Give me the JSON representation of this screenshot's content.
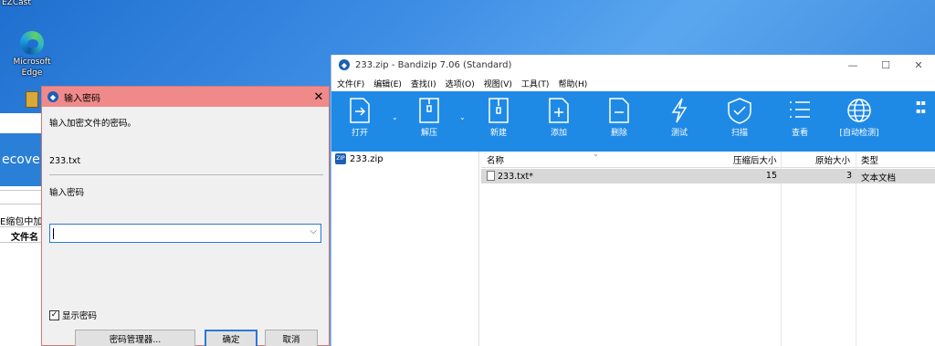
{
  "desktop": {
    "top_label": "EZCast",
    "edge_label_line1": "Microsoft",
    "edge_label_line2": "Edge"
  },
  "background_app": {
    "banner_text": "ecove",
    "text1": "E缩包中加",
    "text2": "文件名"
  },
  "password_dialog": {
    "title": "输入密码",
    "close_glyph": "✕",
    "prompt": "输入加密文件的密码。",
    "filename": "233.txt",
    "field_label": "输入密码",
    "input_value": "",
    "dropdown_glyph": "⌵",
    "show_password_label": "显示密码",
    "show_password_checked": true,
    "manager_button": "密码管理器...",
    "ok_button": "确定",
    "cancel_button": "取消"
  },
  "bandizip": {
    "title": "233.zip - Bandizip 7.06 (Standard)",
    "window_controls": [
      "—",
      "☐",
      "✕"
    ],
    "menu": [
      "文件(F)",
      "编辑(E)",
      "查找(I)",
      "选项(O)",
      "视图(V)",
      "工具(T)",
      "帮助(H)"
    ],
    "toolbar": [
      {
        "label": "打开",
        "icon": "open-icon"
      },
      {
        "label": "解压",
        "icon": "extract-icon"
      },
      {
        "label": "新建",
        "icon": "new-archive-icon"
      },
      {
        "label": "添加",
        "icon": "add-icon"
      },
      {
        "label": "删除",
        "icon": "delete-icon"
      },
      {
        "label": "测试",
        "icon": "test-icon"
      },
      {
        "label": "扫描",
        "icon": "scan-icon"
      },
      {
        "label": "查看",
        "icon": "view-icon"
      },
      {
        "label": "[自动检测]",
        "icon": "codepage-icon"
      }
    ],
    "toolbar_color": "#1f8ae6",
    "tree_item": "233.zip",
    "columns": [
      "名称",
      "压缩后大小",
      "原始大小",
      "类型"
    ],
    "rows": [
      {
        "name": "233.txt*",
        "packed": "15",
        "original": "3",
        "type": "文本文档"
      }
    ]
  }
}
